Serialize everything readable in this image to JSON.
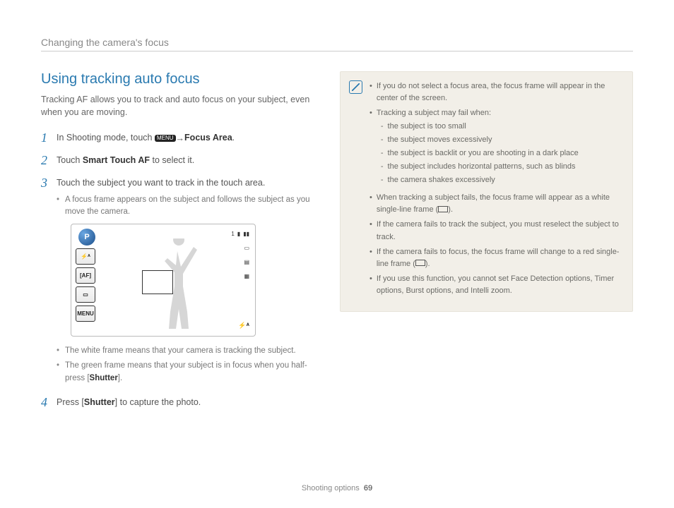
{
  "header": "Changing the camera's focus",
  "title": "Using tracking auto focus",
  "intro": "Tracking AF allows you to track and auto focus on your subject, even when you are moving.",
  "steps": {
    "s1_pre": "In Shooting mode, touch ",
    "s1_menu": "MENU",
    "s1_arrow": " → ",
    "s1_focus_area": "Focus Area",
    "s1_end": ".",
    "s2_pre": "Touch ",
    "s2_bold": "Smart Touch AF",
    "s2_end": " to select it.",
    "s3": "Touch the subject you want to track in the touch area.",
    "s3_sub1": "A focus frame appears on the subject and follows the subject as you move the camera.",
    "s3_sub2": "The white frame means that your camera is tracking the subject.",
    "s3_sub3_a": "The green frame means that your subject is in focus when you half-press [",
    "s3_sub3_b": "Shutter",
    "s3_sub3_c": "].",
    "s4_a": "Press [",
    "s4_b": "Shutter",
    "s4_c": "] to capture the photo."
  },
  "screen": {
    "count": "1",
    "p": "P",
    "sidebar": {
      "flash": "⚡ᴬ",
      "af": "[AF]",
      "rect": "▭",
      "menu": "MENU"
    },
    "flash_br": "⚡ᴬ"
  },
  "notes": {
    "n1": "If you do not select a focus area, the focus frame will appear in the center of the screen.",
    "n2": "Tracking a subject may fail when:",
    "n2a": "the subject is too small",
    "n2b": "the subject moves excessively",
    "n2c": "the subject is backlit or you are shooting in a dark place",
    "n2d": "the subject includes horizontal patterns, such as blinds",
    "n2e": "the camera shakes excessively",
    "n3a": "When tracking a subject fails, the focus frame will appear as a white single-line frame (",
    "n3b": ").",
    "n4": "If the camera fails to track the subject, you must reselect the subject to track.",
    "n5a": "If the camera fails to focus, the focus frame will change to a red single-line frame (",
    "n5b": ").",
    "n6": "If you use this function, you cannot set Face Detection options, Timer options, Burst options, and Intelli zoom."
  },
  "footer": {
    "section": "Shooting options",
    "page": "69"
  }
}
